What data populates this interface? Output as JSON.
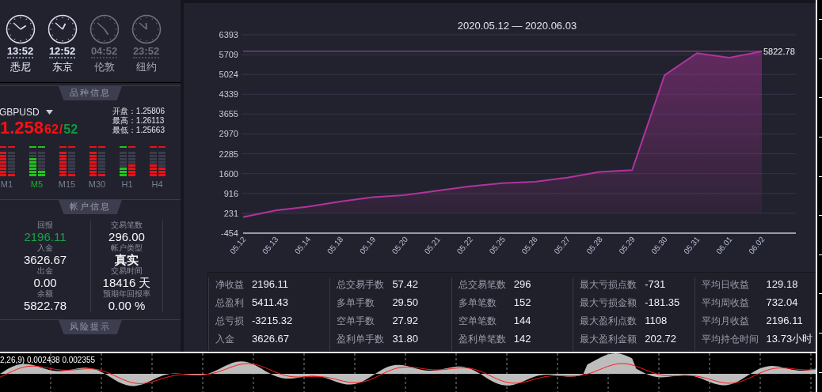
{
  "clocks": [
    {
      "time": "13:52",
      "city": "悉尼",
      "active": true
    },
    {
      "time": "12:52",
      "city": "东京",
      "active": true
    },
    {
      "time": "04:52",
      "city": "伦敦",
      "active": false
    },
    {
      "time": "23:52",
      "city": "纽约",
      "active": false
    }
  ],
  "symbol_section": {
    "title": "品种信息",
    "symbol": "GBPUSD",
    "price_main": "1.258",
    "price_bid": "62",
    "separator": "/",
    "price_ask": "52",
    "quotes": [
      "开盘：1.25806",
      "最高：1.26113",
      "最低：1.25663"
    ],
    "timeframes": [
      {
        "label": "M1",
        "selected": false,
        "columns": [
          {
            "level": 1,
            "color": "#e0151b"
          },
          {
            "level": 0.12,
            "color": "#e0151b"
          }
        ]
      },
      {
        "label": "M5",
        "selected": true,
        "columns": [
          {
            "level": 0.75,
            "color": "#22c31e"
          },
          {
            "level": 0.25,
            "color": "#22c31e"
          }
        ]
      },
      {
        "label": "M15",
        "selected": false,
        "columns": [
          {
            "level": 1,
            "color": "#e0151b"
          },
          {
            "level": 0.12,
            "color": "#e0151b"
          }
        ]
      },
      {
        "label": "M30",
        "selected": false,
        "columns": [
          {
            "level": 1,
            "color": "#e0151b"
          },
          {
            "level": 0.12,
            "color": "#e0151b"
          }
        ]
      },
      {
        "label": "H1",
        "selected": false,
        "columns": [
          {
            "level": 0.38,
            "color": "#22c31e"
          },
          {
            "level": 0.5,
            "color": "#e0151b"
          }
        ]
      },
      {
        "label": "H4",
        "selected": false,
        "columns": [
          {
            "level": 0.5,
            "color": "#e0151b"
          },
          {
            "level": 0.38,
            "color": "#e0151b"
          }
        ]
      }
    ]
  },
  "account_section": {
    "title": "帐户信息",
    "columns": [
      [
        {
          "label": "回报",
          "value": "2196.11",
          "kind": "gain"
        },
        {
          "label": "入金",
          "value": "3626.67",
          "kind": "plain"
        },
        {
          "label": "出金",
          "value": "0.00",
          "kind": "plain"
        },
        {
          "label": "余额",
          "value": "5822.78",
          "kind": "plain"
        }
      ],
      [
        {
          "label": "交易笔数",
          "value": "296.00",
          "kind": "plain"
        },
        {
          "label": "帐户类型",
          "value": "真实",
          "kind": "strong"
        },
        {
          "label": "交易时间",
          "value": "18416 天",
          "kind": "plain"
        },
        {
          "label": "预期年回报率",
          "value": "0.00 %",
          "kind": "plain"
        }
      ]
    ]
  },
  "risk_section": {
    "title": "风险提示"
  },
  "chart": {
    "chart_data": {
      "type": "area",
      "title": "2020.05.12 — 2020.06.03",
      "categories": [
        "05.12",
        "05.13",
        "05.14",
        "05.18",
        "05.19",
        "05.20",
        "05.21",
        "05.22",
        "05.25",
        "05.26",
        "05.27",
        "05.28",
        "05.29",
        "05.30",
        "05.31",
        "06.01",
        "06.02"
      ],
      "series": [
        {
          "color": "#b0349c",
          "values": [
            100,
            330,
            460,
            640,
            790,
            860,
            1010,
            1160,
            1270,
            1320,
            1460,
            1660,
            1720,
            5000,
            5760,
            5600,
            5820
          ]
        }
      ],
      "ylim": [
        -454,
        6393
      ],
      "yticks": [
        6393,
        5709,
        5024,
        4339,
        3655,
        2970,
        2285,
        1600,
        916,
        231,
        -454
      ],
      "grid": true,
      "ref_lines": [
        {
          "axis": "y",
          "value": 5822.78,
          "label": "5822.78"
        }
      ]
    }
  },
  "stats": [
    [
      {
        "label": "净收益",
        "value": "2196.11"
      },
      {
        "label": "总盈利",
        "value": "5411.43"
      },
      {
        "label": "总亏损",
        "value": "-3215.32"
      },
      {
        "label": "入金",
        "value": "3626.67"
      }
    ],
    [
      {
        "label": "总交易手数",
        "value": "57.42"
      },
      {
        "label": "多单手数",
        "value": "29.50"
      },
      {
        "label": "空单手数",
        "value": "27.92"
      },
      {
        "label": "盈利单手数",
        "value": "31.80"
      }
    ],
    [
      {
        "label": "总交易笔数",
        "value": "296"
      },
      {
        "label": "多单笔数",
        "value": "152"
      },
      {
        "label": "空单笔数",
        "value": "144"
      },
      {
        "label": "盈利单笔数",
        "value": "142"
      }
    ],
    [
      {
        "label": "最大亏损点数",
        "value": "-731"
      },
      {
        "label": "最大亏损金额",
        "value": "-181.35"
      },
      {
        "label": "最大盈利点数",
        "value": "1108"
      },
      {
        "label": "最大盈利金额",
        "value": "202.72"
      }
    ],
    [
      {
        "label": "平均日收益",
        "value": "129.18"
      },
      {
        "label": "平均周收益",
        "value": "732.04"
      },
      {
        "label": "平均月收益",
        "value": "2196.11"
      },
      {
        "label": "平均持仓时间",
        "value": "13.73小时"
      }
    ]
  ],
  "indicator": {
    "label": "2,26,9) 0.002438 0.002355"
  }
}
